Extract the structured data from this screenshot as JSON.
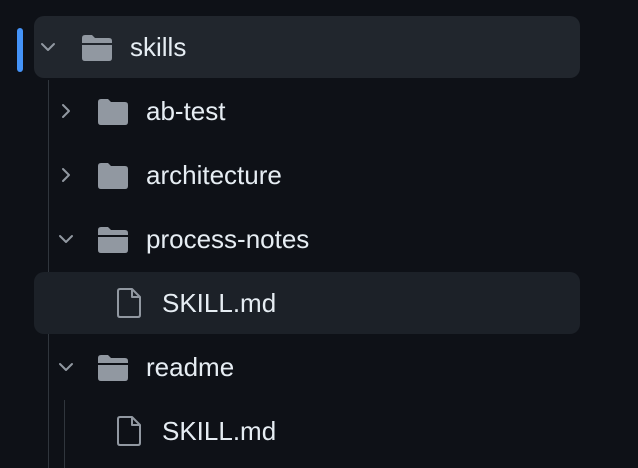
{
  "file_tree": {
    "root": {
      "label": "skills",
      "icon": "folder-open-icon",
      "expanded": true
    },
    "items": [
      {
        "label": "ab-test",
        "icon": "folder-icon",
        "expanded": false
      },
      {
        "label": "architecture",
        "icon": "folder-icon",
        "expanded": false
      },
      {
        "label": "process-notes",
        "icon": "folder-open-icon",
        "expanded": true,
        "children": [
          {
            "label": "SKILL.md",
            "icon": "file-icon"
          }
        ]
      },
      {
        "label": "readme",
        "icon": "folder-open-icon",
        "expanded": true,
        "children": [
          {
            "label": "SKILL.md",
            "icon": "file-icon"
          }
        ]
      }
    ]
  },
  "colors": {
    "background": "#0e1117",
    "selected_row": "#21262d",
    "hover_row": "#1c2128",
    "active_indicator": "#4493f8",
    "text": "#e6edf3",
    "icon": "#9198a1",
    "guide_line": "#30363d"
  }
}
